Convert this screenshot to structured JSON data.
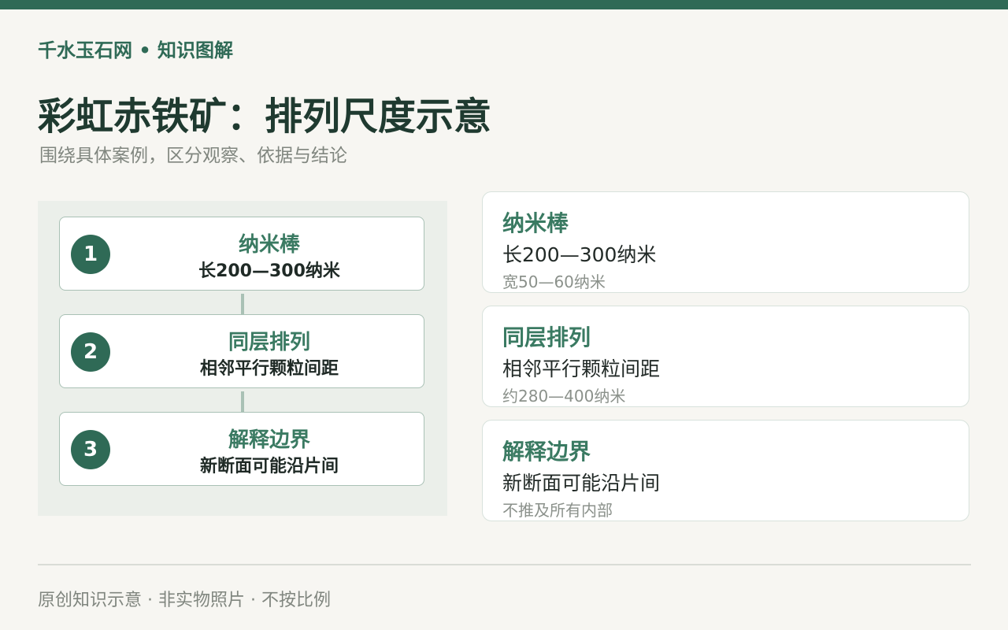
{
  "site_name": "千水玉石网 • 知识图解",
  "title": "彩虹赤铁矿：排列尺度示意",
  "subtitle": "围绕具体案例，区分观察、依据与结论",
  "steps": [
    {
      "number": "1",
      "title": "纳米棒",
      "desc": "长200—300纳米"
    },
    {
      "number": "2",
      "title": "同层排列",
      "desc": "相邻平行颗粒间距"
    },
    {
      "number": "3",
      "title": "解释边界",
      "desc": "新断面可能沿片间"
    }
  ],
  "cards": [
    {
      "title": "纳米棒",
      "main": "长200—300纳米",
      "sub": "宽50—60纳米"
    },
    {
      "title": "同层排列",
      "main": "相邻平行颗粒间距",
      "sub": "约280—400纳米"
    },
    {
      "title": "解释边界",
      "main": "新断面可能沿片间",
      "sub": "不推及所有内部"
    }
  ],
  "footer": "原创知识示意 · 非实物照片 · 不按比例",
  "colors": {
    "accent": "#2f6a56",
    "title_green": "#3a7a62",
    "panel_bg": "#ebefea",
    "page_bg": "#f7f6f2"
  }
}
